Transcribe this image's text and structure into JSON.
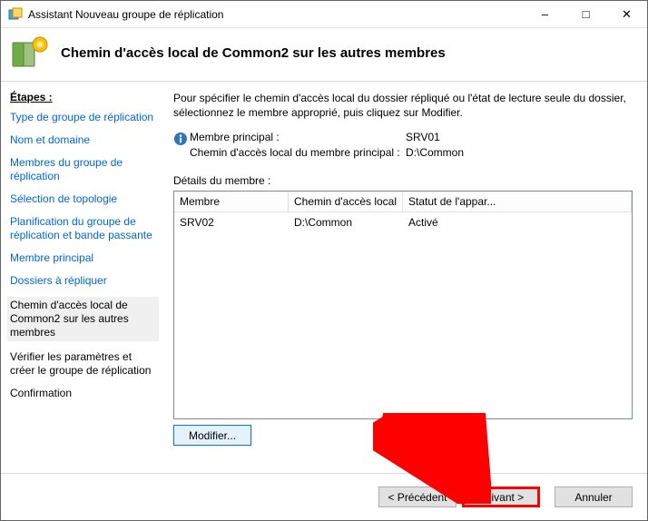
{
  "title": "Assistant Nouveau groupe de réplication",
  "header_title": "Chemin d'accès local de Common2 sur les autres membres",
  "sidebar": {
    "title": "Étapes :",
    "steps": [
      {
        "label": "Type de groupe de réplication",
        "state": "done"
      },
      {
        "label": "Nom et domaine",
        "state": "done"
      },
      {
        "label": "Membres du groupe de réplication",
        "state": "done"
      },
      {
        "label": "Sélection de topologie",
        "state": "done"
      },
      {
        "label": "Planification du groupe de réplication et bande passante",
        "state": "done"
      },
      {
        "label": "Membre principal",
        "state": "done"
      },
      {
        "label": "Dossiers à répliquer",
        "state": "done"
      },
      {
        "label": "Chemin d'accès local de Common2 sur les autres membres",
        "state": "current"
      },
      {
        "label": "Vérifier les paramètres et créer le groupe de réplication",
        "state": "future"
      },
      {
        "label": "Confirmation",
        "state": "future"
      }
    ]
  },
  "main": {
    "instruction": "Pour spécifier le chemin d'accès local du dossier répliqué ou l'état de lecture seule du dossier, sélectionnez le membre approprié, puis cliquez sur Modifier.",
    "principal_member_label": "Membre principal :",
    "principal_member_value": "SRV01",
    "principal_path_label": "Chemin d'accès local du membre principal :",
    "principal_path_value": "D:\\Common",
    "details_label": "Détails du membre :",
    "columns": {
      "c1": "Membre",
      "c2": "Chemin d'accès local",
      "c3": "Statut de l'appar..."
    },
    "rows": [
      {
        "c1": "SRV02",
        "c2": "D:\\Common",
        "c3": "Activé"
      }
    ],
    "modify_label": "Modifier..."
  },
  "footer": {
    "prev": "< Précédent",
    "next": "Suivant >",
    "cancel": "Annuler"
  }
}
